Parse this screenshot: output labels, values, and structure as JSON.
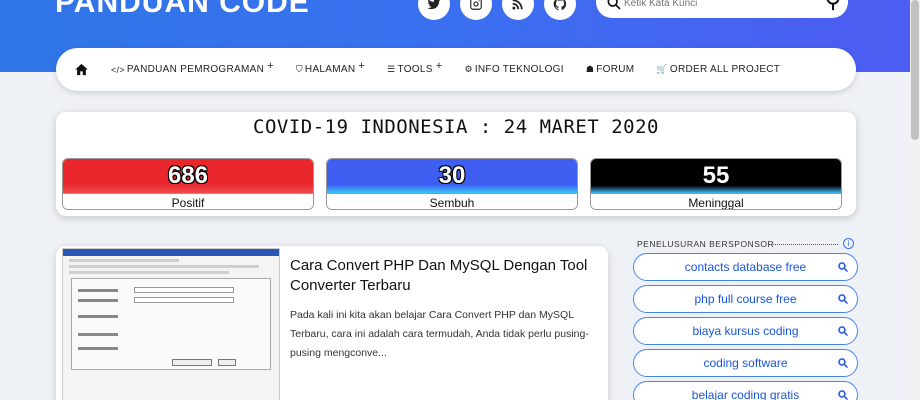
{
  "header": {
    "brand": "PANDUAN CODE",
    "search_placeholder": "Ketik Kata Kunci"
  },
  "social": [
    "twitter-icon",
    "instagram-icon",
    "rss-icon",
    "github-icon"
  ],
  "nav": {
    "items": [
      {
        "icon": "</>",
        "label": "PANDUAN PEMROGRAMAN",
        "plus": "+"
      },
      {
        "icon": "⛉",
        "label": "HALAMAN",
        "plus": "+"
      },
      {
        "icon": "☰",
        "label": "TOOLS",
        "plus": "+"
      },
      {
        "icon": "⚙",
        "label": "INFO TEKNOLOGI",
        "plus": ""
      },
      {
        "icon": "☗",
        "label": "FORUM",
        "plus": ""
      },
      {
        "icon": "🛒",
        "label": "ORDER ALL PROJECT",
        "plus": ""
      }
    ]
  },
  "covid": {
    "title": "COVID-19 INDONESIA : 24 MARET 2020",
    "positif": {
      "value": "686",
      "label": "Positif"
    },
    "sembuh": {
      "value": "30",
      "label": "Sembuh"
    },
    "meninggal": {
      "value": "55",
      "label": "Meninggal"
    }
  },
  "post": {
    "title": "Cara Convert PHP Dan MySQL Dengan Tool Converter Terbaru",
    "excerpt": "Pada kali ini kita akan belajar Cara Convert PHP dan MySQL Terbaru, cara ini adalah cara termudah, Anda tidak perlu pusing-pusing mengconve..."
  },
  "sidebar": {
    "heading": "PENELUSURAN BERSPONSOR",
    "items": [
      "contacts database free",
      "php full course free",
      "biaya kursus coding",
      "coding software",
      "belajar coding gratis"
    ]
  },
  "colors": {
    "accent": "#3a6ff0",
    "positif": "#e8262b",
    "sembuh": "#3f5ef2",
    "meninggal": "#000000"
  }
}
